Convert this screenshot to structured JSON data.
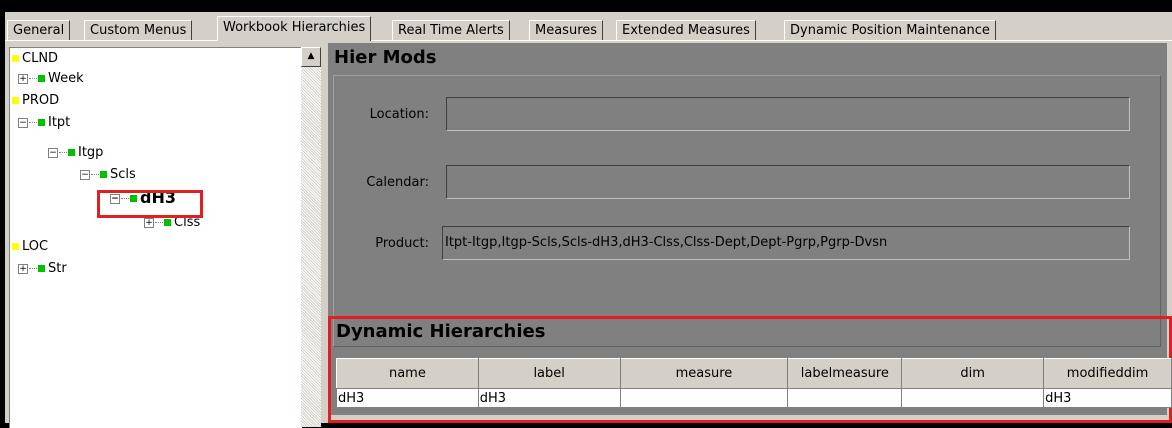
{
  "tabs": [
    {
      "label": "General",
      "active": false
    },
    {
      "label": "Custom Menus",
      "active": false
    },
    {
      "label": "Workbook Hierarchies",
      "active": true
    },
    {
      "label": "Real Time Alerts",
      "active": false
    },
    {
      "label": "Measures",
      "active": false
    },
    {
      "label": "Extended Measures",
      "active": false
    },
    {
      "label": "Dynamic Position Maintenance",
      "active": false
    }
  ],
  "tree": {
    "nodes": [
      {
        "label": "CLND",
        "type": "dimension"
      },
      {
        "label": "Week",
        "type": "level"
      },
      {
        "label": "PROD",
        "type": "dimension"
      },
      {
        "label": "Itpt",
        "type": "level"
      },
      {
        "label": "Itgp",
        "type": "level"
      },
      {
        "label": "Scls",
        "type": "level"
      },
      {
        "label": "dH3",
        "type": "level",
        "selected": true
      },
      {
        "label": "Clss",
        "type": "level"
      },
      {
        "label": "LOC",
        "type": "dimension"
      },
      {
        "label": "Str",
        "type": "level"
      }
    ]
  },
  "hier_mods": {
    "title": "Hier Mods",
    "location_label": "Location:",
    "location_value": "",
    "calendar_label": "Calendar:",
    "calendar_value": "",
    "product_label": "Product:",
    "product_value": "Itpt-Itgp,Itgp-Scls,Scls-dH3,dH3-Clss,Clss-Dept,Dept-Pgrp,Pgrp-Dvsn"
  },
  "dynamic_hierarchies": {
    "title": "Dynamic Hierarchies",
    "columns": [
      "name",
      "label",
      "measure",
      "labelmeasure",
      "dim",
      "modifieddim"
    ],
    "rows": [
      [
        "dH3",
        "dH3",
        "",
        "",
        "",
        "dH3"
      ]
    ]
  },
  "colors": {
    "highlight": "#e02020",
    "panel_bg": "#808080",
    "chrome_bg": "#d4d0c8",
    "dimension_marker": "#ffff00",
    "level_marker": "#00c000"
  }
}
